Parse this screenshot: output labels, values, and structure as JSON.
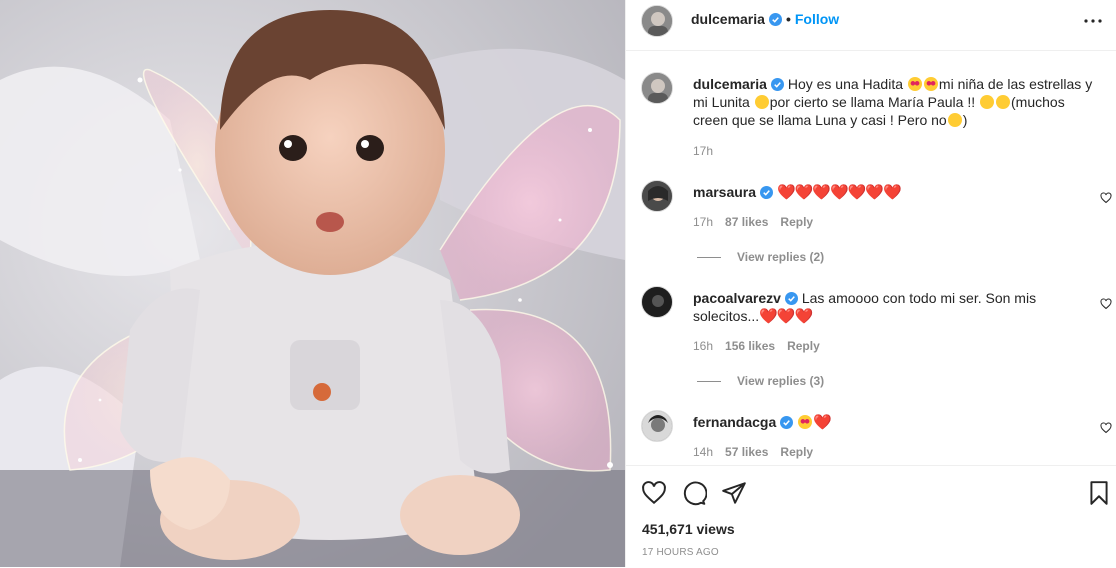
{
  "post": {
    "author": "dulcemaria",
    "follow_label": "Follow",
    "separator": "•"
  },
  "caption": {
    "username": "dulcemaria",
    "text_1": "Hoy es una Hadita ",
    "text_2": "mi niña de las estrellas y mi Lunita ",
    "text_3": "por cierto se llama María Paula !! ",
    "text_4": "(muchos creen que se llama Luna y casi ! Pero no",
    "text_5": ")",
    "time": "17h"
  },
  "comments": [
    {
      "username": "marsaura",
      "text": "❤️❤️❤️❤️❤️❤️❤️",
      "time": "17h",
      "likes": "87 likes",
      "reply": "Reply",
      "view_replies": "View replies (2)"
    },
    {
      "username": "pacoalvarezv",
      "text": "Las amoooo con todo mi ser. Son mis solecitos...",
      "hearts": "❤️❤️❤️",
      "time": "16h",
      "likes": "156 likes",
      "reply": "Reply",
      "view_replies": "View replies (3)"
    },
    {
      "username": "fernandacga",
      "hearts": "❤️",
      "time": "14h",
      "likes": "57 likes",
      "reply": "Reply"
    }
  ],
  "stats": {
    "views": "451,671 views",
    "posted": "17 HOURS AGO"
  },
  "icons": {
    "like": "heart-outline-icon",
    "comment": "comment-bubble-icon",
    "share": "paper-plane-icon",
    "save": "bookmark-icon",
    "more": "more-horizontal-icon",
    "verified": "verified-badge-icon"
  },
  "colors": {
    "link_blue": "#0095f6",
    "verified_blue": "#3897f0",
    "heart_red": "#e0245e",
    "muted_gray": "#8e8e8e"
  }
}
